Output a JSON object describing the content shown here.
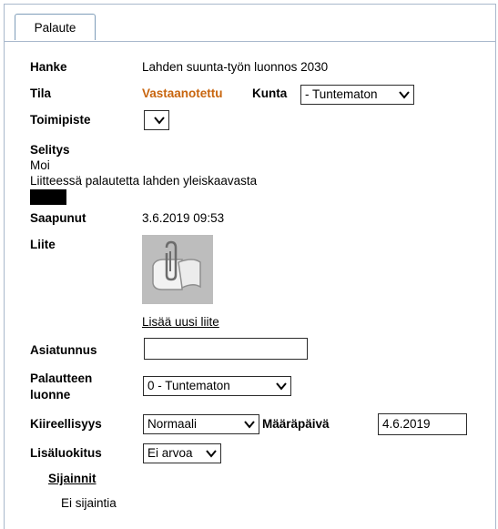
{
  "tab": {
    "label": "Palaute"
  },
  "fields": {
    "hanke_label": "Hanke",
    "hanke_value": "Lahden suunta-työn luonnos 2030",
    "tila_label": "Tila",
    "tila_value": "Vastaanotettu",
    "kunta_label": "Kunta",
    "kunta_value": "- Tuntematon",
    "toimipiste_label": "Toimipiste",
    "toimipiste_value": "",
    "selitys_label": "Selitys",
    "selitys_line1": "Moi",
    "selitys_line2": "Liitteessä palautetta lahden yleiskaavasta",
    "saapunut_label": "Saapunut",
    "saapunut_value": "3.6.2019 09:53",
    "liite_label": "Liite",
    "add_attachment": "Lisää uusi liite",
    "asiatunnus_label": "Asiatunnus",
    "asiatunnus_value": "",
    "luonne_label_1": "Palautteen",
    "luonne_label_2": "luonne",
    "luonne_value": "0 - Tuntematon",
    "kiireellisyys_label": "Kiireellisyys",
    "kiireellisyys_value": "Normaali",
    "maarapaiva_label": "Määräpäivä",
    "maarapaiva_value": "4.6.2019",
    "lisaluokitus_label": "Lisäluokitus",
    "lisaluokitus_value": "Ei arvoa",
    "sijainnit_link": "Sijainnit",
    "sijainnit_empty": "Ei sijaintia"
  },
  "colors": {
    "status": "#c8650e",
    "border": "#a9b8cc"
  },
  "icons": {
    "attachment": "paperclip-document-icon",
    "dropdown": "chevron-down-icon"
  }
}
